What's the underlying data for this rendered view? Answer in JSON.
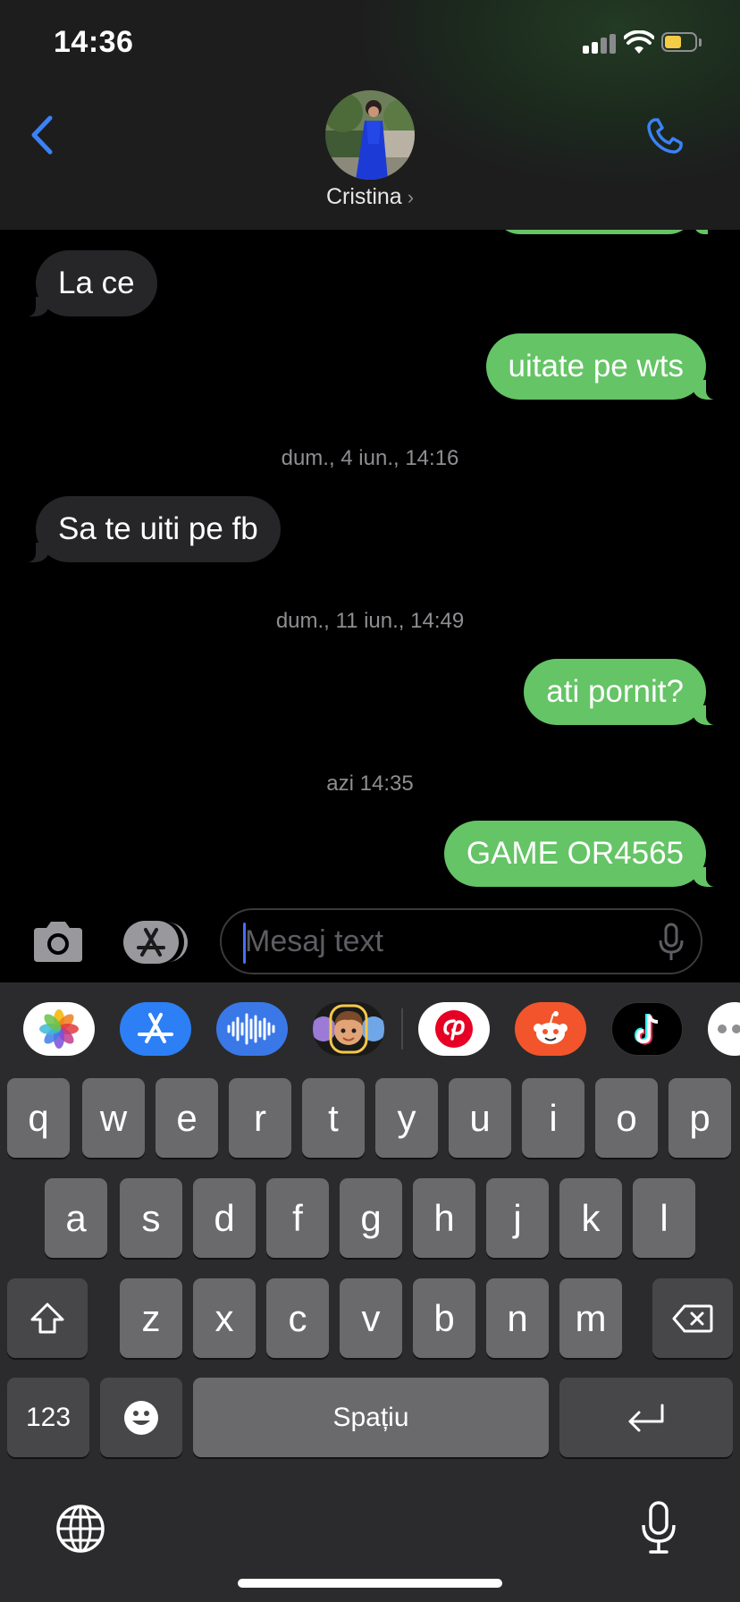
{
  "status_bar": {
    "time": "14:36",
    "battery_color": "#f4cc45"
  },
  "header": {
    "back_icon": "chevron-left-icon",
    "contact_name": "Cristina",
    "call_icon": "phone-icon",
    "accent_color": "#3b82f6"
  },
  "messages": [
    {
      "type": "incoming",
      "text": "La ce"
    },
    {
      "type": "outgoing",
      "text": "uitate pe wts"
    },
    {
      "type": "timestamp",
      "text": "dum., 4 iun., 14:16"
    },
    {
      "type": "incoming",
      "text": "Sa te uiti pe fb"
    },
    {
      "type": "timestamp",
      "text": "dum., 11 iun., 14:49"
    },
    {
      "type": "outgoing",
      "text": "ati pornit?"
    },
    {
      "type": "timestamp",
      "text": "azi 14:35"
    },
    {
      "type": "outgoing",
      "text": "GAME OR4565"
    }
  ],
  "composer": {
    "placeholder": "Mesaj text",
    "camera_icon": "camera-icon",
    "apps_icon": "app-store-icon",
    "mic_icon": "microphone-icon"
  },
  "app_strip": [
    "photos-icon",
    "app-store-icon",
    "audio-message-icon",
    "memoji-icon",
    "pinterest-icon",
    "reddit-icon",
    "tiktok-icon",
    "more-apps-icon"
  ],
  "keyboard": {
    "row1": [
      "q",
      "w",
      "e",
      "r",
      "t",
      "y",
      "u",
      "i",
      "o",
      "p"
    ],
    "row2": [
      "a",
      "s",
      "d",
      "f",
      "g",
      "h",
      "j",
      "k",
      "l"
    ],
    "row3": [
      "z",
      "x",
      "c",
      "v",
      "b",
      "n",
      "m"
    ],
    "numbers_label": "123",
    "space_label": "Spațiu",
    "shift_icon": "shift-icon",
    "delete_icon": "delete-icon",
    "return_icon": "return-icon",
    "emoji_icon": "emoji-icon",
    "globe_icon": "globe-icon",
    "dictation_icon": "microphone-icon"
  }
}
